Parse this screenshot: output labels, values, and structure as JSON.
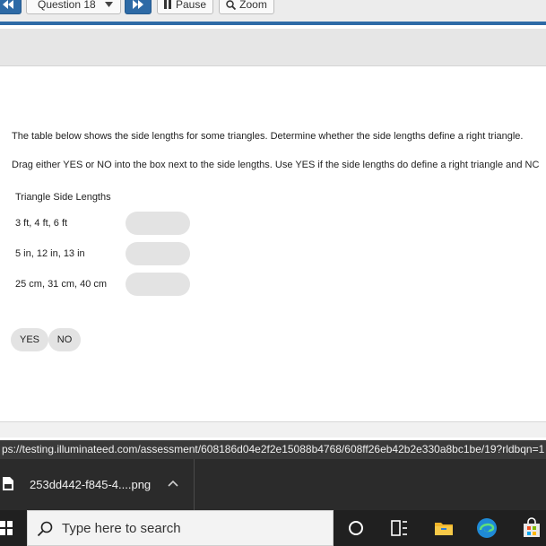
{
  "toolbar": {
    "question_select": "Question 18",
    "pause_label": "Pause",
    "zoom_label": "Zoom"
  },
  "question": {
    "text": "The table below shows the side lengths for some triangles. Determine whether the side lengths define a right triangle.",
    "instructions": "Drag either YES or NO into the box next to the side lengths. Use YES if the side lengths do define a right triangle and NC",
    "table_title": "Triangle Side Lengths",
    "rows": [
      {
        "label": "3 ft, 4 ft, 6 ft"
      },
      {
        "label": "5 in, 12 in, 13 in"
      },
      {
        "label": "25 cm, 31 cm, 40 cm"
      }
    ],
    "choices": {
      "yes": "YES",
      "no": "NO"
    }
  },
  "status_bar": {
    "url": "ps://testing.illuminateed.com/assessment/608186d04e2f2e15088b4768/608ff26eb42b2e330a8bc1be/19?rldbqn=1"
  },
  "downloads": {
    "file_name": "253dd442-f845-4....png"
  },
  "taskbar": {
    "search_placeholder": "Type here to search"
  },
  "colors": {
    "accent": "#2d6aa6",
    "chip": "#e3e3e3",
    "taskbar": "#202020"
  }
}
